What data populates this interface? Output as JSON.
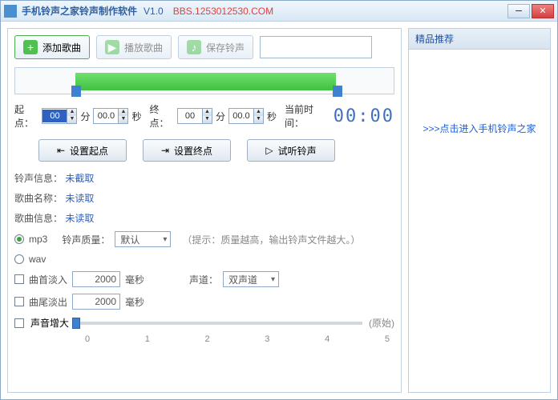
{
  "titlebar": {
    "title": "手机铃声之家铃声制作软件",
    "version": "V1.0",
    "url": "BBS.1253012530.COM"
  },
  "toolbar": {
    "add": "添加歌曲",
    "play": "播放歌曲",
    "save": "保存铃声"
  },
  "time": {
    "start_label": "起点：",
    "start_min": "00",
    "start_sec": "00.0",
    "min_unit": "分",
    "sec_unit": "秒",
    "end_label": "终点：",
    "end_min": "00",
    "end_sec": "00.0",
    "current_label": "当前时间：",
    "digital": "00:00"
  },
  "buttons": {
    "set_start": "设置起点",
    "set_end": "设置终点",
    "preview": "试听铃声"
  },
  "info": {
    "ring_label": "铃声信息：",
    "ring_val": "未截取",
    "name_label": "歌曲名称：",
    "name_val": "未读取",
    "song_label": "歌曲信息：",
    "song_val": "未读取"
  },
  "format": {
    "mp3": "mp3",
    "quality_label": "铃声质量：",
    "quality_val": "默认",
    "hint": "（提示：质量越高，输出铃声文件越大。）",
    "wav": "wav"
  },
  "fade": {
    "in_label": "曲首淡入",
    "in_val": "2000",
    "out_label": "曲尾淡出",
    "out_val": "2000",
    "unit": "毫秒",
    "channel_label": "声道：",
    "channel_val": "双声道"
  },
  "volume": {
    "label": "声音增大",
    "orig": "(原始)"
  },
  "ruler": [
    "0",
    "1",
    "2",
    "3",
    "4",
    "5"
  ],
  "side": {
    "header": "精品推荐",
    "link": ">>>点击进入手机铃声之家"
  }
}
